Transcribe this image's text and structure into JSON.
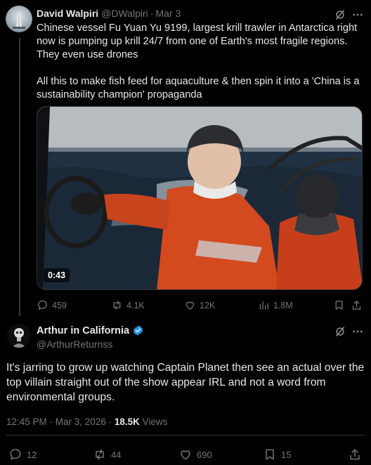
{
  "parent_tweet": {
    "author_name": "David Walpiri",
    "author_handle": "@DWalpiri",
    "separator": "·",
    "date": "Mar 3",
    "text": "Chinese vessel Fu Yuan Yu 9199,  largest krill trawler in Antarctica right now is pumping up krill 24/7 from one of Earth's most fragile regions. They even use drones\n\nAll this to make fish feed for aquaculture & then spin it into a 'China is a sustainability champion' propaganda",
    "video_duration": "0:43",
    "stats": {
      "replies": "459",
      "reposts": "4.1K",
      "likes": "12K",
      "views": "1.8M"
    }
  },
  "reply_tweet": {
    "author_name": "Arthur in California",
    "author_handle": "@ArthurReturnss",
    "text": "It's jarring to grow up watching Captain Planet then see an actual over the top villain straight out of the show appear IRL and not a word from environmental groups.",
    "timestamp": "12:45 PM · Mar 3, 2026 · ",
    "view_count": "18.5K",
    "views_label": " Views",
    "stats": {
      "replies": "12",
      "reposts": "44",
      "likes": "690",
      "bookmarks": "15"
    }
  },
  "colors": {
    "background": "#000000",
    "text": "#e7e9ea",
    "muted": "#71767b",
    "verified": "#1d9bf0",
    "divider": "#2f3336"
  },
  "icons": [
    "grok-icon",
    "more-options-icon",
    "reply-icon",
    "repost-icon",
    "like-icon",
    "views-icon",
    "bookmark-icon",
    "share-icon",
    "verified-badge-icon"
  ]
}
